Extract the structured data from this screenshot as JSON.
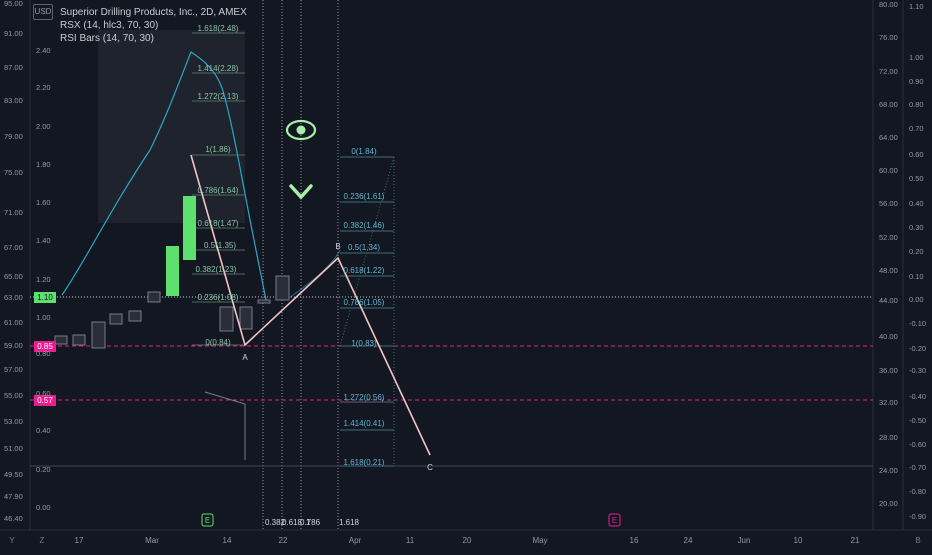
{
  "header": {
    "currency": "USD",
    "symbol_line": "Superior Drilling Products, Inc., 2D, AMEX",
    "indicator_1": "RSX (14, hlc3, 70, 30)",
    "indicator_2": "RSI Bars (14, 70, 30)"
  },
  "left_axis_outer": [
    "95.00",
    "91.00",
    "87.00",
    "83.00",
    "79.00",
    "75.00",
    "71.00",
    "67.00",
    "65.00",
    "63.00",
    "61.00",
    "59.00",
    "57.00",
    "55.00",
    "53.00",
    "51.00",
    "49.50",
    "47.90",
    "46.40"
  ],
  "left_axis_inner": [
    "2.40",
    "2.20",
    "2.00",
    "1.80",
    "1.60",
    "1.40",
    "1.20",
    "1.00",
    "0.80",
    "0.60",
    "0.40",
    "0.20",
    "0.00"
  ],
  "left_badges": {
    "current": "1.10",
    "level_a": "0.85",
    "level_b": "0.57"
  },
  "right_axis_outer": [
    "80.00",
    "76.00",
    "72.00",
    "68.00",
    "64.00",
    "60.00",
    "56.00",
    "52.00",
    "48.00",
    "44.00",
    "40.00",
    "36.00",
    "32.00",
    "28.00",
    "24.00",
    "20.00"
  ],
  "right_axis_inner": [
    "1.10",
    "1.00",
    "0.90",
    "0.80",
    "0.70",
    "0.60",
    "0.50",
    "0.40",
    "0.30",
    "0.20",
    "0.10",
    "0.00",
    "-0.10",
    "-0.20",
    "-0.30",
    "-0.40",
    "-0.50",
    "-0.60",
    "-0.70",
    "-0.80",
    "-0.90"
  ],
  "time_axis": [
    "17",
    "Mar",
    "14",
    "22",
    "Apr",
    "11",
    "20",
    "May",
    "16",
    "24",
    "Jun",
    "10",
    "21"
  ],
  "corner_left": "Y",
  "corner_z": "Z",
  "corner_right": "B",
  "fib_retracement": [
    "1.618(2.48)",
    "1.414(2.28)",
    "1.272(2.13)",
    "1(1.86)",
    "0.786(1.64)",
    "0.618(1.47)",
    "0.5(1.35)",
    "0.382(1.23)",
    "0.236(1.08)",
    "0(0.84)"
  ],
  "fib_extension": [
    "0(1.84)",
    "0.236(1.61)",
    "0.382(1.46)",
    "0.5(1.34)",
    "0.618(1.22)",
    "0.786(1.05)",
    "1(0.83)",
    "1.272(0.56)",
    "1.414(0.41)",
    "1.618(0.21)"
  ],
  "wave_labels": {
    "a": "A",
    "b": "B",
    "c": "C"
  },
  "fib_time_labels": {
    "t1": "0.382",
    "t2": "0.618",
    "t3": "0.786",
    "t4": "1",
    "t5": "1.618"
  },
  "event_markers": {
    "earnings_1": "E",
    "earnings_2": "E"
  },
  "colors": {
    "background": "#131722",
    "bull": "#5ee06e",
    "bear": "#2a2e39",
    "rsx": "#2aa6c8",
    "fib": "#8bc4a4",
    "wave": "#f2b7b7",
    "magenta": "#e91e8f",
    "eye": "#a8f0a8"
  }
}
